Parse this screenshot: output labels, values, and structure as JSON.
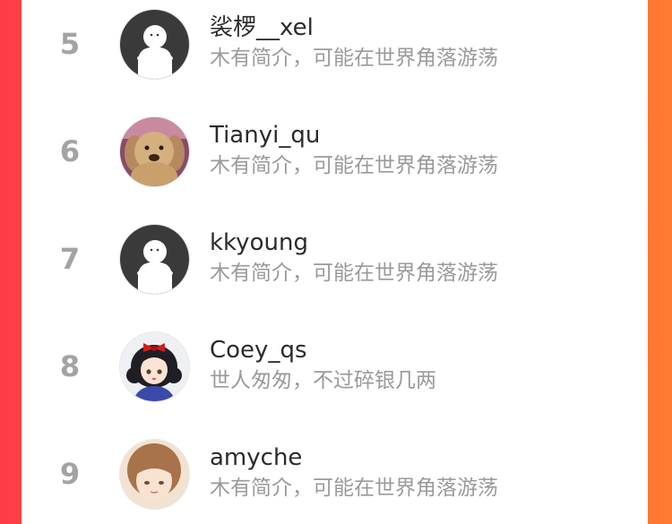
{
  "colors": {
    "background_gradient_start": "#ff3c46",
    "background_gradient_end": "#ff7a32",
    "rank": "#a3a3a3",
    "name": "#2b2b2b",
    "bio": "#9a9a9a"
  },
  "ranking": [
    {
      "rank": "5",
      "name": "裟椤__xel",
      "bio": "木有简介，可能在世界角落游荡",
      "avatar": "default-avatar-icon"
    },
    {
      "rank": "6",
      "name": "Tianyi_qu",
      "bio": "木有简介，可能在世界角落游荡",
      "avatar": "plush-dog-avatar"
    },
    {
      "rank": "7",
      "name": "kkyoung",
      "bio": "木有简介，可能在世界角落游荡",
      "avatar": "default-avatar-icon"
    },
    {
      "rank": "8",
      "name": "Coey_qs",
      "bio": "世人匆匆，不过碎银几两",
      "avatar": "cartoon-girl-avatar"
    },
    {
      "rank": "9",
      "name": "amyche",
      "bio": "木有简介，可能在世界角落游荡",
      "avatar": "cartoon-person-avatar"
    }
  ]
}
